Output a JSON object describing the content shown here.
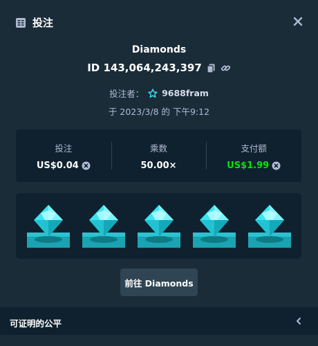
{
  "header": {
    "title": "投注",
    "icon": "bet-slip-icon",
    "close_icon": "close-icon"
  },
  "bet": {
    "game": "Diamonds",
    "id": "ID 143,064,243,397",
    "bettor_label": "投注者：",
    "bettor_name": "9688fram",
    "date": "于 2023/3/8 的 下午9:12"
  },
  "stats": [
    {
      "label": "投注",
      "value": "US$0.04",
      "icon": "coin-icon"
    },
    {
      "label": "乘数",
      "value": "50.00×"
    },
    {
      "label": "支付额",
      "value": "US$1.99",
      "icon": "coin-icon",
      "color": "#00e701"
    }
  ],
  "grid": {
    "gems": [
      "diamond",
      "diamond",
      "diamond",
      "diamond",
      "diamond"
    ],
    "gem_color": "#3be4f0",
    "base_color": "#1aa3b2"
  },
  "go_button": "前往 Diamonds",
  "footer": {
    "label": "可证明的公平",
    "icon": "chevron-left-icon"
  }
}
